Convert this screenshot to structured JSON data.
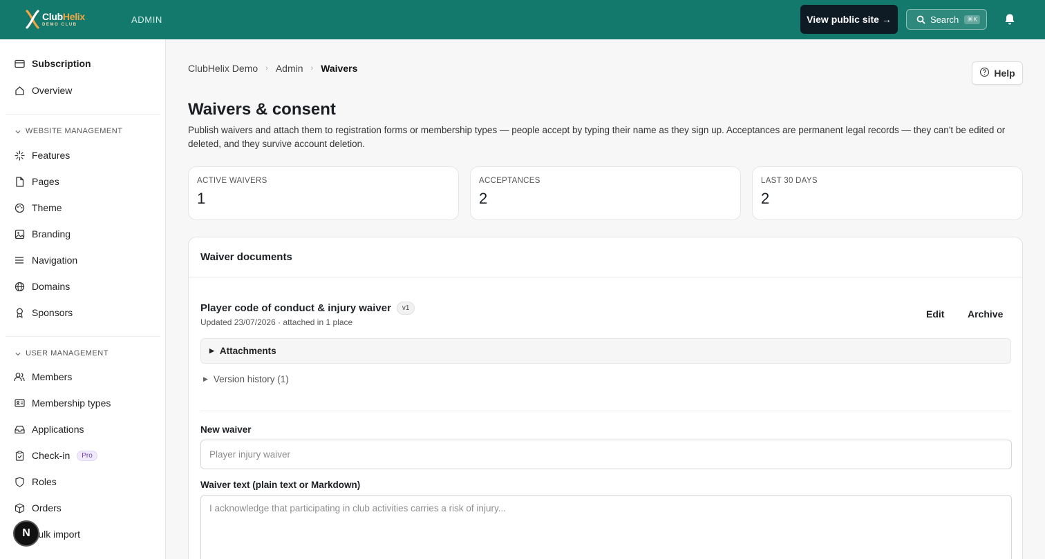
{
  "header": {
    "logo_name_part1": "Club",
    "logo_name_part2": "Helix",
    "logo_sub": "DEMO CLUB",
    "section_label": "ADMIN",
    "view_public_label": "View public site →",
    "search_label": "Search",
    "search_shortcut": "⌘K"
  },
  "sidebar": {
    "top_items": [
      {
        "label": "Subscription",
        "icon": "card-icon"
      },
      {
        "label": "Overview",
        "icon": "home-icon"
      }
    ],
    "sections": [
      {
        "title": "WEBSITE MANAGEMENT",
        "items": [
          {
            "label": "Features",
            "icon": "sparkle-icon"
          },
          {
            "label": "Pages",
            "icon": "file-icon"
          },
          {
            "label": "Theme",
            "icon": "palette-icon"
          },
          {
            "label": "Branding",
            "icon": "image-icon"
          },
          {
            "label": "Navigation",
            "icon": "menu-icon"
          },
          {
            "label": "Domains",
            "icon": "globe-icon"
          },
          {
            "label": "Sponsors",
            "icon": "award-icon"
          }
        ]
      },
      {
        "title": "USER MANAGEMENT",
        "items": [
          {
            "label": "Members",
            "icon": "users-icon"
          },
          {
            "label": "Membership types",
            "icon": "id-card-icon"
          },
          {
            "label": "Applications",
            "icon": "inbox-icon"
          },
          {
            "label": "Check-in",
            "icon": "clipboard-check-icon",
            "badge": "Pro"
          },
          {
            "label": "Roles",
            "icon": "shield-icon"
          },
          {
            "label": "Orders",
            "icon": "box-icon"
          },
          {
            "label": "Bulk import",
            "icon": "upload-icon"
          }
        ]
      }
    ],
    "avatar_letter": "N"
  },
  "breadcrumb": [
    "ClubHelix Demo",
    "Admin",
    "Waivers"
  ],
  "help_label": "Help",
  "page": {
    "title": "Waivers & consent",
    "description": "Publish waivers and attach them to registration forms or membership types — people accept by typing their name as they sign up. Acceptances are permanent legal records — they can't be edited or deleted, and they survive account deletion."
  },
  "stats": [
    {
      "label": "ACTIVE WAIVERS",
      "value": "1"
    },
    {
      "label": "ACCEPTANCES",
      "value": "2"
    },
    {
      "label": "LAST 30 DAYS",
      "value": "2"
    }
  ],
  "documents": {
    "panel_title": "Waiver documents",
    "waiver": {
      "title": "Player code of conduct & injury waiver",
      "version": "v1",
      "meta": "Updated 23/07/2026 · attached in 1 place",
      "edit_label": "Edit",
      "archive_label": "Archive",
      "attachments_label": "Attachments",
      "version_history_label": "Version history (1)"
    },
    "new_waiver": {
      "label": "New waiver",
      "name_value": "",
      "name_placeholder": "Player injury waiver",
      "text_label": "Waiver text (plain text or Markdown)",
      "text_value": "",
      "text_placeholder": "I acknowledge that participating in club activities carries a risk of injury..."
    }
  },
  "colors": {
    "topbar": "#13796c",
    "public_button": "#0e1a24",
    "logo_accent": "#f2a541",
    "pro_badge": "#6d3fb3"
  }
}
